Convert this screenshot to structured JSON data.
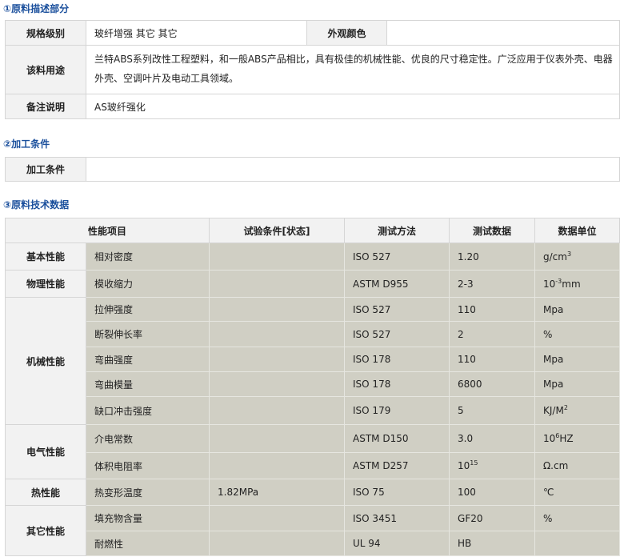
{
  "section1": {
    "title": "①原料描述部分",
    "spec_label": "规格级别",
    "spec_value": "玻纤增强 其它 其它",
    "color_label": "外观颜色",
    "color_value": "",
    "usage_label": "该料用途",
    "usage_value": "兰特ABS系列改性工程塑料，和一般ABS产品相比，具有极佳的机械性能、优良的尺寸稳定性。广泛应用于仪表外壳、电器外壳、空调叶片及电动工具领域。",
    "remark_label": "备注说明",
    "remark_value": "AS玻纤强化"
  },
  "section2": {
    "title": "②加工条件",
    "label": "加工条件",
    "value": ""
  },
  "section3": {
    "title": "③原料技术数据",
    "headers": [
      "性能项目",
      "试验条件[状态]",
      "测试方法",
      "测试数据",
      "数据单位"
    ],
    "groups": [
      {
        "category": "基本性能",
        "rows": [
          {
            "item": "相对密度",
            "condition": "",
            "method": "ISO 527",
            "value": "1.20",
            "unit": "g/cm",
            "unit_sup": "3",
            "unit_after": ""
          }
        ]
      },
      {
        "category": "物理性能",
        "rows": [
          {
            "item": "模收缩力",
            "condition": "",
            "method": "ASTM D955",
            "value": "2-3",
            "unit": "10",
            "unit_sup": "-3",
            "unit_after": "mm"
          }
        ]
      },
      {
        "category": "机械性能",
        "rows": [
          {
            "item": "拉伸强度",
            "condition": "",
            "method": "ISO 527",
            "value": "110",
            "unit": "Mpa",
            "unit_sup": "",
            "unit_after": ""
          },
          {
            "item": "断裂伸长率",
            "condition": "",
            "method": "ISO 527",
            "value": "2",
            "unit": "%",
            "unit_sup": "",
            "unit_after": ""
          },
          {
            "item": "弯曲强度",
            "condition": "",
            "method": "ISO 178",
            "value": "110",
            "unit": "Mpa",
            "unit_sup": "",
            "unit_after": ""
          },
          {
            "item": "弯曲模量",
            "condition": "",
            "method": "ISO 178",
            "value": "6800",
            "unit": "Mpa",
            "unit_sup": "",
            "unit_after": ""
          },
          {
            "item": "缺口冲击强度",
            "condition": "",
            "method": "ISO 179",
            "value": "5",
            "unit": "KJ/M",
            "unit_sup": "2",
            "unit_after": ""
          }
        ]
      },
      {
        "category": "电气性能",
        "rows": [
          {
            "item": "介电常数",
            "condition": "",
            "method": "ASTM D150",
            "value": "3.0",
            "unit": "10",
            "unit_sup": "6",
            "unit_after": "HZ"
          },
          {
            "item": "体积电阻率",
            "condition": "",
            "method": "ASTM D257",
            "value": "10",
            "value_sup": "15",
            "unit": "Ω.cm",
            "unit_sup": "",
            "unit_after": ""
          }
        ]
      },
      {
        "category": "热性能",
        "rows": [
          {
            "item": "热变形温度",
            "condition": "1.82MPa",
            "method": "ISO 75",
            "value": "100",
            "unit": "℃",
            "unit_sup": "",
            "unit_after": ""
          }
        ]
      },
      {
        "category": "其它性能",
        "rows": [
          {
            "item": "填充物含量",
            "condition": "",
            "method": "ISO 3451",
            "value": "GF20",
            "unit": "%",
            "unit_sup": "",
            "unit_after": ""
          },
          {
            "item": "耐燃性",
            "condition": "",
            "method": "UL 94",
            "value": "HB",
            "unit": "",
            "unit_sup": "",
            "unit_after": ""
          }
        ]
      }
    ]
  }
}
